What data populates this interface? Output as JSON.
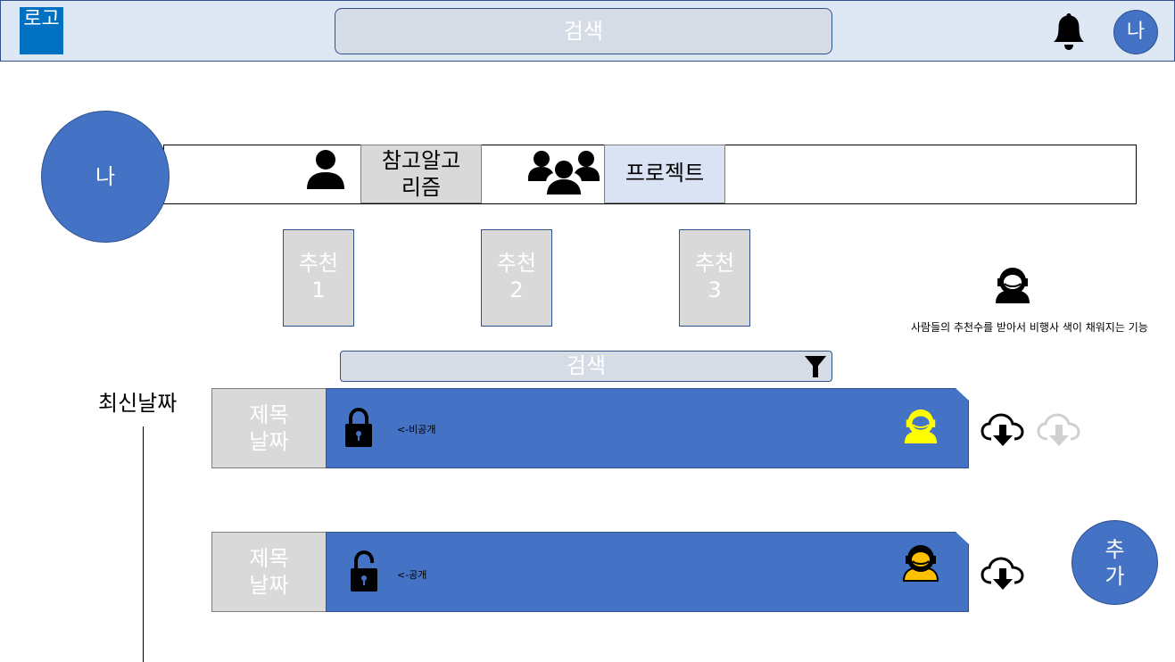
{
  "header": {
    "logo": "로고",
    "search_label": "검색",
    "bell_icon": "bell-icon",
    "avatar_label": "나"
  },
  "profile": {
    "avatar_label": "나",
    "tabs": [
      {
        "label_line1": "참고알고",
        "label_line2": "리즘",
        "icon": "person-icon"
      },
      {
        "label": "프로젝트",
        "icon": "group-icon"
      }
    ]
  },
  "recommendations": [
    {
      "line1": "추천",
      "line2": "1"
    },
    {
      "line1": "추천",
      "line2": "2"
    },
    {
      "line1": "추천",
      "line2": "3"
    }
  ],
  "astronaut_note": "사람들의 추천수를 받아서 비행사 색이 채워지는 기능",
  "list": {
    "search_label": "검색",
    "filter_icon": "filter-icon",
    "sort_label": "최신날짜",
    "items": [
      {
        "title": "제목",
        "date": "날짜",
        "visibility_note": "<-비공개",
        "lock_icon": "lock-closed-icon",
        "astronaut_color": "#ffff00"
      },
      {
        "title": "제목",
        "date": "날짜",
        "visibility_note": "<-공개",
        "lock_icon": "lock-open-icon",
        "astronaut_color": "#ffc000"
      }
    ]
  },
  "add_button": {
    "line1": "추",
    "line2": "가"
  },
  "colors": {
    "accent": "#4472c4",
    "header_bg": "#dee8f5",
    "border": "#2f528f",
    "gray": "#d9d9d9"
  }
}
